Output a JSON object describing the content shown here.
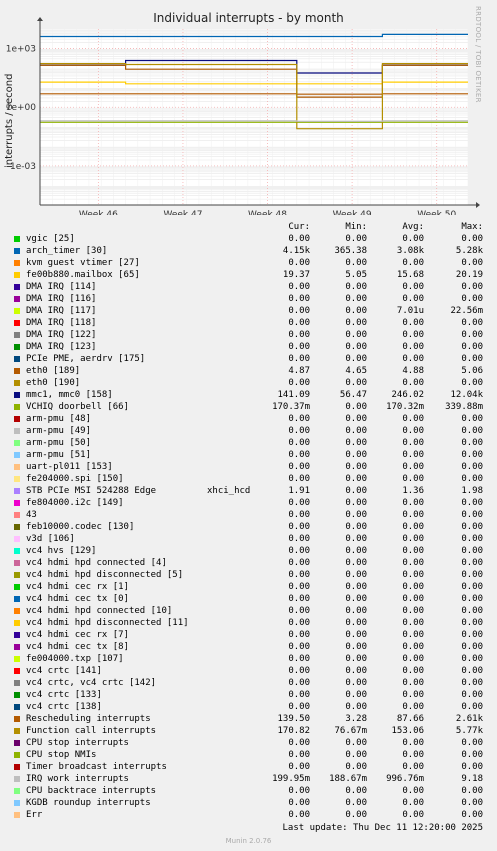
{
  "chart_data": {
    "type": "line",
    "title": "Individual interrupts - by month",
    "ylabel": "interrupts / second",
    "yscale": "log",
    "ylim": [
      1e-05,
      10000
    ],
    "y_ticks": [
      "1e+03",
      "1e+00",
      "1e-03"
    ],
    "y_tick_values": [
      1000,
      1,
      0.001
    ],
    "x_ticks": [
      "Week 46",
      "Week 47",
      "Week 48",
      "Week 49",
      "Week 50"
    ],
    "grid": true,
    "series": [
      {
        "name": "arch_timer [30]",
        "color": "#0066b3",
        "values": [
          4150,
          4150,
          4150,
          4150,
          5280
        ]
      },
      {
        "name": "fe00b880.mailbox [65]",
        "color": "#ffcc00",
        "values": [
          19.37,
          15.68,
          15.68,
          15.68,
          19.37
        ]
      },
      {
        "name": "eth0 [189]",
        "color": "#b35a00",
        "values": [
          4.87,
          4.87,
          4.87,
          4.65,
          4.88
        ]
      },
      {
        "name": "mmc1, mmc0 [158]",
        "color": "#0a0d80",
        "values": [
          141.09,
          246.02,
          246.02,
          56.47,
          141.09
        ]
      },
      {
        "name": "VCHIQ doorbell [66]",
        "color": "#8fb300",
        "values": [
          0.17,
          0.17,
          0.17,
          0.17,
          0.17
        ]
      },
      {
        "name": "Rescheduling interrupts",
        "color": "#ab5700",
        "values": [
          139.5,
          87.66,
          87.66,
          3.28,
          139.5
        ]
      },
      {
        "name": "Function call interrupts",
        "color": "#b38f00",
        "values": [
          170.82,
          153.06,
          153.06,
          0.08,
          170.82
        ]
      },
      {
        "name": "IRQ work interrupts",
        "color": "#bbbbbb",
        "values": [
          0.2,
          0.2,
          0.2,
          0.19,
          0.2
        ]
      }
    ]
  },
  "legend_headers": {
    "cur": "Cur:",
    "min": "Min:",
    "avg": "Avg:",
    "max": "Max:"
  },
  "legend": [
    {
      "color": "#00cc00",
      "label": "vgic [25]",
      "cur": "0.00",
      "min": "0.00",
      "avg": "0.00",
      "max": "0.00"
    },
    {
      "color": "#0066b3",
      "label": "arch_timer [30]",
      "cur": "4.15k",
      "min": "365.38",
      "avg": "3.08k",
      "max": "5.28k"
    },
    {
      "color": "#ff8000",
      "label": "kvm guest vtimer [27]",
      "cur": "0.00",
      "min": "0.00",
      "avg": "0.00",
      "max": "0.00"
    },
    {
      "color": "#ffcc00",
      "label": "fe00b880.mailbox [65]",
      "cur": "19.37",
      "min": "5.05",
      "avg": "15.68",
      "max": "20.19"
    },
    {
      "color": "#330099",
      "label": "DMA IRQ [114]",
      "cur": "0.00",
      "min": "0.00",
      "avg": "0.00",
      "max": "0.00"
    },
    {
      "color": "#990099",
      "label": "DMA IRQ [116]",
      "cur": "0.00",
      "min": "0.00",
      "avg": "0.00",
      "max": "0.00"
    },
    {
      "color": "#ccff00",
      "label": "DMA IRQ [117]",
      "cur": "0.00",
      "min": "0.00",
      "avg": "7.01u",
      "max": "22.56m"
    },
    {
      "color": "#ff0000",
      "label": "DMA IRQ [118]",
      "cur": "0.00",
      "min": "0.00",
      "avg": "0.00",
      "max": "0.00"
    },
    {
      "color": "#808080",
      "label": "DMA IRQ [122]",
      "cur": "0.00",
      "min": "0.00",
      "avg": "0.00",
      "max": "0.00"
    },
    {
      "color": "#008f00",
      "label": "DMA IRQ [123]",
      "cur": "0.00",
      "min": "0.00",
      "avg": "0.00",
      "max": "0.00"
    },
    {
      "color": "#00487d",
      "label": "PCIe PME, aerdrv [175]",
      "cur": "0.00",
      "min": "0.00",
      "avg": "0.00",
      "max": "0.00"
    },
    {
      "color": "#b35a00",
      "label": "eth0 [189]",
      "cur": "4.87",
      "min": "4.65",
      "avg": "4.88",
      "max": "5.06"
    },
    {
      "color": "#b38f00",
      "label": "eth0 [190]",
      "cur": "0.00",
      "min": "0.00",
      "avg": "0.00",
      "max": "0.00"
    },
    {
      "color": "#0a0d80",
      "label": "mmc1, mmc0 [158]",
      "cur": "141.09",
      "min": "56.47",
      "avg": "246.02",
      "max": "12.04k"
    },
    {
      "color": "#8fb300",
      "label": "VCHIQ doorbell [66]",
      "cur": "170.37m",
      "min": "0.00",
      "avg": "170.32m",
      "max": "339.88m"
    },
    {
      "color": "#b30000",
      "label": "arm-pmu [48]",
      "cur": "0.00",
      "min": "0.00",
      "avg": "0.00",
      "max": "0.00"
    },
    {
      "color": "#bebebe",
      "label": "arm-pmu [49]",
      "cur": "0.00",
      "min": "0.00",
      "avg": "0.00",
      "max": "0.00"
    },
    {
      "color": "#80ff80",
      "label": "arm-pmu [50]",
      "cur": "0.00",
      "min": "0.00",
      "avg": "0.00",
      "max": "0.00"
    },
    {
      "color": "#80c9ff",
      "label": "arm-pmu [51]",
      "cur": "0.00",
      "min": "0.00",
      "avg": "0.00",
      "max": "0.00"
    },
    {
      "color": "#ffc080",
      "label": "uart-pl011 [153]",
      "cur": "0.00",
      "min": "0.00",
      "avg": "0.00",
      "max": "0.00"
    },
    {
      "color": "#ffe680",
      "label": "fe204000.spi [150]",
      "cur": "0.00",
      "min": "0.00",
      "avg": "0.00",
      "max": "0.00"
    },
    {
      "color": "#aa80ff",
      "label": "STB PCIe MSI 524288 Edge",
      "extra": "xhci_hcd",
      "cur": "1.91",
      "min": "0.00",
      "avg": "1.36",
      "max": "1.98"
    },
    {
      "color": "#ee00cc",
      "label": "fe804000.i2c [149]",
      "cur": "0.00",
      "min": "0.00",
      "avg": "0.00",
      "max": "0.00"
    },
    {
      "color": "#ff8080",
      "label": "43",
      "cur": "0.00",
      "min": "0.00",
      "avg": "0.00",
      "max": "0.00"
    },
    {
      "color": "#666600",
      "label": "feb10000.codec [130]",
      "cur": "0.00",
      "min": "0.00",
      "avg": "0.00",
      "max": "0.00"
    },
    {
      "color": "#ffbfff",
      "label": "v3d [106]",
      "cur": "0.00",
      "min": "0.00",
      "avg": "0.00",
      "max": "0.00"
    },
    {
      "color": "#00ffcc",
      "label": "vc4 hvs [129]",
      "cur": "0.00",
      "min": "0.00",
      "avg": "0.00",
      "max": "0.00"
    },
    {
      "color": "#cc6699",
      "label": "vc4 hdmi hpd connected [4]",
      "cur": "0.00",
      "min": "0.00",
      "avg": "0.00",
      "max": "0.00"
    },
    {
      "color": "#999900",
      "label": "vc4 hdmi hpd disconnected [5]",
      "cur": "0.00",
      "min": "0.00",
      "avg": "0.00",
      "max": "0.00"
    },
    {
      "color": "#00cc00",
      "label": "vc4 hdmi cec rx [1]",
      "cur": "0.00",
      "min": "0.00",
      "avg": "0.00",
      "max": "0.00"
    },
    {
      "color": "#0066b3",
      "label": "vc4 hdmi cec tx [0]",
      "cur": "0.00",
      "min": "0.00",
      "avg": "0.00",
      "max": "0.00"
    },
    {
      "color": "#ff8000",
      "label": "vc4 hdmi hpd connected [10]",
      "cur": "0.00",
      "min": "0.00",
      "avg": "0.00",
      "max": "0.00"
    },
    {
      "color": "#ffcc00",
      "label": "vc4 hdmi hpd disconnected [11]",
      "cur": "0.00",
      "min": "0.00",
      "avg": "0.00",
      "max": "0.00"
    },
    {
      "color": "#330099",
      "label": "vc4 hdmi cec rx [7]",
      "cur": "0.00",
      "min": "0.00",
      "avg": "0.00",
      "max": "0.00"
    },
    {
      "color": "#990099",
      "label": "vc4 hdmi cec tx [8]",
      "cur": "0.00",
      "min": "0.00",
      "avg": "0.00",
      "max": "0.00"
    },
    {
      "color": "#ccff00",
      "label": "fe004000.txp [107]",
      "cur": "0.00",
      "min": "0.00",
      "avg": "0.00",
      "max": "0.00"
    },
    {
      "color": "#ff0000",
      "label": "vc4 crtc [141]",
      "cur": "0.00",
      "min": "0.00",
      "avg": "0.00",
      "max": "0.00"
    },
    {
      "color": "#808080",
      "label": "vc4 crtc, vc4 crtc [142]",
      "cur": "0.00",
      "min": "0.00",
      "avg": "0.00",
      "max": "0.00"
    },
    {
      "color": "#008f00",
      "label": "vc4 crtc [133]",
      "cur": "0.00",
      "min": "0.00",
      "avg": "0.00",
      "max": "0.00"
    },
    {
      "color": "#00487d",
      "label": "vc4 crtc [138]",
      "cur": "0.00",
      "min": "0.00",
      "avg": "0.00",
      "max": "0.00"
    },
    {
      "color": "#b35a00",
      "label": "Rescheduling interrupts",
      "cur": "139.50",
      "min": "3.28",
      "avg": "87.66",
      "max": "2.61k"
    },
    {
      "color": "#b38f00",
      "label": "Function call interrupts",
      "cur": "170.82",
      "min": "76.67m",
      "avg": "153.06",
      "max": "5.77k"
    },
    {
      "color": "#6b006b",
      "label": "CPU stop interrupts",
      "cur": "0.00",
      "min": "0.00",
      "avg": "0.00",
      "max": "0.00"
    },
    {
      "color": "#8fb300",
      "label": "CPU stop NMIs",
      "cur": "0.00",
      "min": "0.00",
      "avg": "0.00",
      "max": "0.00"
    },
    {
      "color": "#b30000",
      "label": "Timer broadcast interrupts",
      "cur": "0.00",
      "min": "0.00",
      "avg": "0.00",
      "max": "0.00"
    },
    {
      "color": "#bebebe",
      "label": "IRQ work interrupts",
      "cur": "199.95m",
      "min": "188.67m",
      "avg": "996.76m",
      "max": "9.18"
    },
    {
      "color": "#80ff80",
      "label": "CPU backtrace interrupts",
      "cur": "0.00",
      "min": "0.00",
      "avg": "0.00",
      "max": "0.00"
    },
    {
      "color": "#80c9ff",
      "label": "KGDB roundup interrupts",
      "cur": "0.00",
      "min": "0.00",
      "avg": "0.00",
      "max": "0.00"
    },
    {
      "color": "#ffc080",
      "label": "Err",
      "cur": "0.00",
      "min": "0.00",
      "avg": "0.00",
      "max": "0.00"
    }
  ],
  "last_update": "Last update: Thu Dec 11 12:20:00 2025",
  "side_text": "RRDTOOL / TOBI OETIKER",
  "footer": "Munin 2.0.76"
}
